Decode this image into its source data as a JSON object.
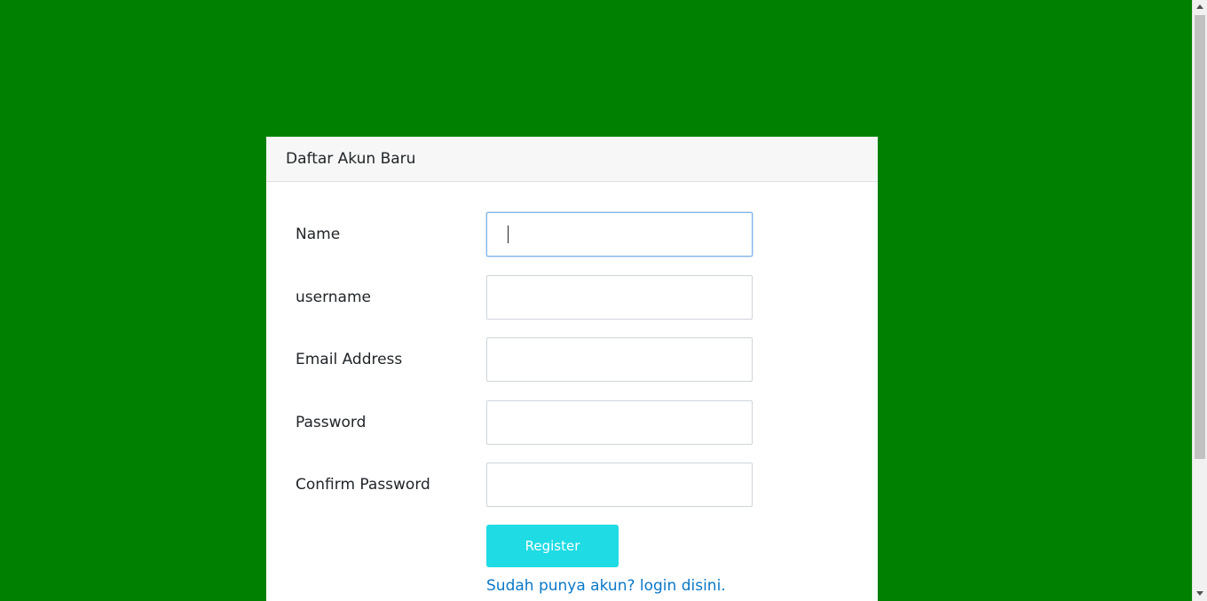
{
  "page": {
    "background_color": "#008000"
  },
  "form": {
    "title": "Daftar Akun Baru",
    "fields": [
      {
        "label": "Name",
        "value": "",
        "focused": true
      },
      {
        "label": "username",
        "value": ""
      },
      {
        "label": "Email Address",
        "value": ""
      },
      {
        "label": "Password",
        "value": ""
      },
      {
        "label": "Confirm Password",
        "value": ""
      }
    ],
    "register_label": "Register",
    "login_link": "Sudah punya akun? login disini."
  },
  "colors": {
    "button": "#1fdbe3",
    "link": "#0a78c8",
    "focus_border": "#80b3e6"
  }
}
